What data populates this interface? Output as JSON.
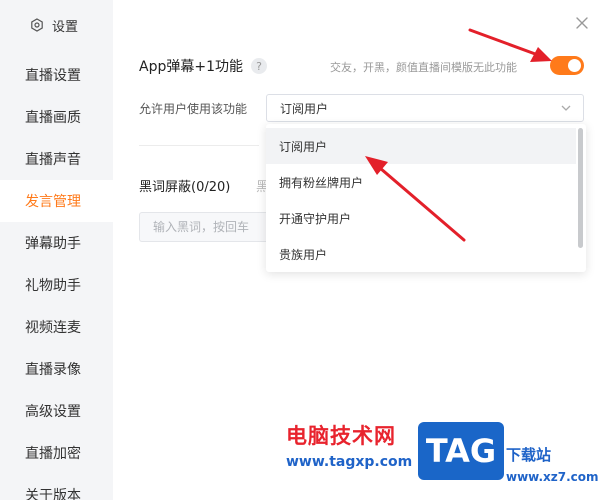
{
  "sidebar": {
    "header": "设置",
    "items": [
      {
        "label": "直播设置"
      },
      {
        "label": "直播画质"
      },
      {
        "label": "直播声音"
      },
      {
        "label": "发言管理",
        "active": true
      },
      {
        "label": "弹幕助手"
      },
      {
        "label": "礼物助手"
      },
      {
        "label": "视频连麦"
      },
      {
        "label": "直播录像"
      },
      {
        "label": "高级设置"
      },
      {
        "label": "直播加密"
      },
      {
        "label": "关于版本"
      }
    ]
  },
  "main": {
    "feature_label": "App弹幕+1功能",
    "help_glyph": "?",
    "feature_desc": "交友，开黑，颜值直播间模版无此功能",
    "toggle_on": true,
    "allow_label": "允许用户使用该功能",
    "select_value": "订阅用户",
    "blackword_label": "黑词屏蔽(0/20)",
    "blackword_extra": "黑",
    "blackword_placeholder": "输入黑词，按回车",
    "dropdown_options": [
      "订阅用户",
      "拥有粉丝牌用户",
      "开通守护用户",
      "贵族用户"
    ]
  },
  "watermark": {
    "cn": "电脑技术网",
    "url": "www.tagxp.com",
    "tag": "TAG",
    "right_1": "下载站",
    "right_2": "www.xz7.com"
  },
  "colors": {
    "accent": "#ff7a1a",
    "arrow": "#e3202a",
    "watermark_red": "#e8232d",
    "watermark_blue": "#1a66c8"
  }
}
